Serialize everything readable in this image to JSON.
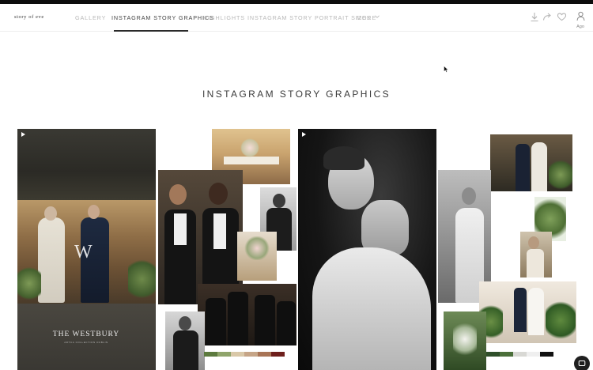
{
  "nav": {
    "brand": "story of eve",
    "tabs": [
      {
        "label": "GALLERY",
        "active": false
      },
      {
        "label": "INSTAGRAM STORY GRAPHICS",
        "active": true
      },
      {
        "label": "HIGHLIGHTS",
        "active": false
      },
      {
        "label": "INSTAGRAM STORY PORTRAIT SIZES",
        "active": false
      },
      {
        "label": "MORE",
        "active": false
      }
    ],
    "actions": {
      "download_icon": "download-icon",
      "share_icon": "share-icon",
      "favorite_icon": "heart-icon",
      "user_icon": "user-icon",
      "user_label": "Ago"
    }
  },
  "main": {
    "section_title": "INSTAGRAM STORY GRAPHICS"
  },
  "panels": {
    "panel1": {
      "westbury_name": "THE WESTBURY",
      "westbury_sub": "ARTCA COLLECTION DUBLIN",
      "monogram": "W"
    },
    "palette_a": [
      "#5c7a3e",
      "#8fa46b",
      "#d9c8a8",
      "#c6a587",
      "#a87456",
      "#6e1f1c"
    ],
    "palette_b": [
      "#2f4f2a",
      "#4b6f3a",
      "#d8d8d4",
      "#efefef",
      "#111111"
    ]
  },
  "colors": {
    "accent": "#2a2a2a",
    "topbar": "#0d0d0d",
    "tab_inactive": "#b8b8b8"
  },
  "chat": {
    "icon": "chat-icon"
  }
}
